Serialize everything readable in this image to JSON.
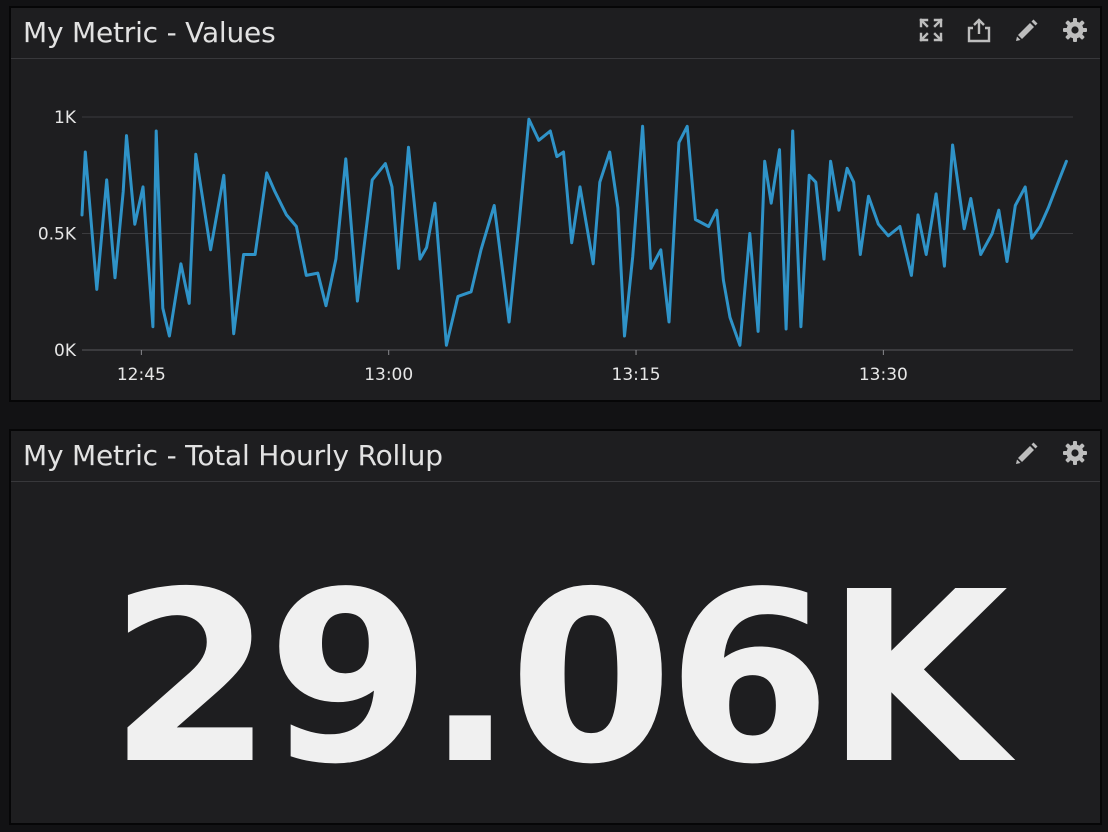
{
  "colors": {
    "panel_bg": "#1e1e20",
    "series": "#2f93c8",
    "grid": "#3b3b3e",
    "text": "#e2e2e2",
    "icon": "#bdbdbd"
  },
  "panels": {
    "values": {
      "title": "My Metric - Values",
      "toolbar": [
        "expand-icon",
        "share-icon",
        "pencil-icon",
        "gear-icon"
      ]
    },
    "rollup": {
      "title": "My Metric - Total Hourly Rollup",
      "value": "29.06K",
      "toolbar": [
        "pencil-icon",
        "gear-icon"
      ]
    }
  },
  "chart_data": {
    "type": "line",
    "title": "My Metric - Values",
    "xlabel": "",
    "ylabel": "",
    "y_ticks": [
      {
        "value": 0,
        "label": "0K"
      },
      {
        "value": 500,
        "label": "0.5K"
      },
      {
        "value": 1000,
        "label": "1K"
      }
    ],
    "x_ticks": [
      {
        "minute": 45,
        "label": "12:45"
      },
      {
        "minute": 60,
        "label": "13:00"
      },
      {
        "minute": 75,
        "label": "13:15"
      },
      {
        "minute": 90,
        "label": "13:30"
      }
    ],
    "xlim": [
      41.4,
      101.5
    ],
    "ylim": [
      0,
      1000
    ],
    "grid": true,
    "legend": "none",
    "series": [
      {
        "x": [
          41.4,
          41.6,
          42.3,
          42.9,
          43.4,
          43.9,
          44.1,
          44.6,
          45.1,
          45.7,
          45.9,
          46.3,
          46.7,
          47.4,
          47.9,
          48.3,
          49.2,
          50.0,
          50.6,
          51.2,
          51.9,
          52.6,
          53.1,
          53.8,
          54.4,
          55.0,
          55.7,
          56.2,
          56.8,
          57.4,
          58.1,
          59.0,
          59.8,
          60.2,
          60.6,
          61.2,
          61.9,
          62.3,
          62.8,
          63.5,
          64.2,
          65.0,
          65.6,
          66.4,
          67.3,
          67.9,
          68.5,
          69.1,
          69.8,
          70.2,
          70.6,
          71.1,
          71.6,
          72.4,
          72.8,
          73.4,
          73.9,
          74.3,
          74.8,
          75.4,
          75.9,
          76.5,
          77.0,
          77.6,
          78.1,
          78.6,
          79.4,
          79.9,
          80.3,
          80.7,
          81.3,
          81.9,
          82.4,
          82.8,
          83.2,
          83.7,
          84.1,
          84.5,
          85.0,
          85.5,
          85.9,
          86.4,
          86.8,
          87.3,
          87.8,
          88.2,
          88.6,
          89.1,
          89.7,
          90.3,
          91.0,
          91.7,
          92.1,
          92.6,
          93.2,
          93.7,
          94.2,
          94.9,
          95.3,
          95.9,
          96.6,
          97.0,
          97.5,
          98.0,
          98.6,
          99.0,
          99.5,
          100.0,
          100.6,
          101.1
        ],
        "values": [
          580,
          850,
          260,
          730,
          310,
          680,
          920,
          540,
          700,
          100,
          940,
          180,
          60,
          370,
          200,
          840,
          430,
          750,
          70,
          410,
          410,
          760,
          680,
          580,
          530,
          320,
          330,
          190,
          390,
          820,
          210,
          730,
          800,
          700,
          350,
          870,
          390,
          440,
          630,
          20,
          230,
          250,
          430,
          620,
          120,
          540,
          990,
          900,
          940,
          830,
          850,
          460,
          700,
          370,
          720,
          850,
          610,
          60,
          400,
          960,
          350,
          430,
          120,
          890,
          960,
          560,
          530,
          600,
          300,
          140,
          20,
          500,
          80,
          810,
          630,
          860,
          90,
          940,
          100,
          750,
          720,
          390,
          810,
          600,
          780,
          720,
          410,
          660,
          540,
          490,
          530,
          320,
          580,
          410,
          670,
          360,
          880,
          520,
          650,
          410,
          500,
          600,
          380,
          620,
          700,
          480,
          530,
          610,
          720,
          810
        ]
      }
    ]
  }
}
